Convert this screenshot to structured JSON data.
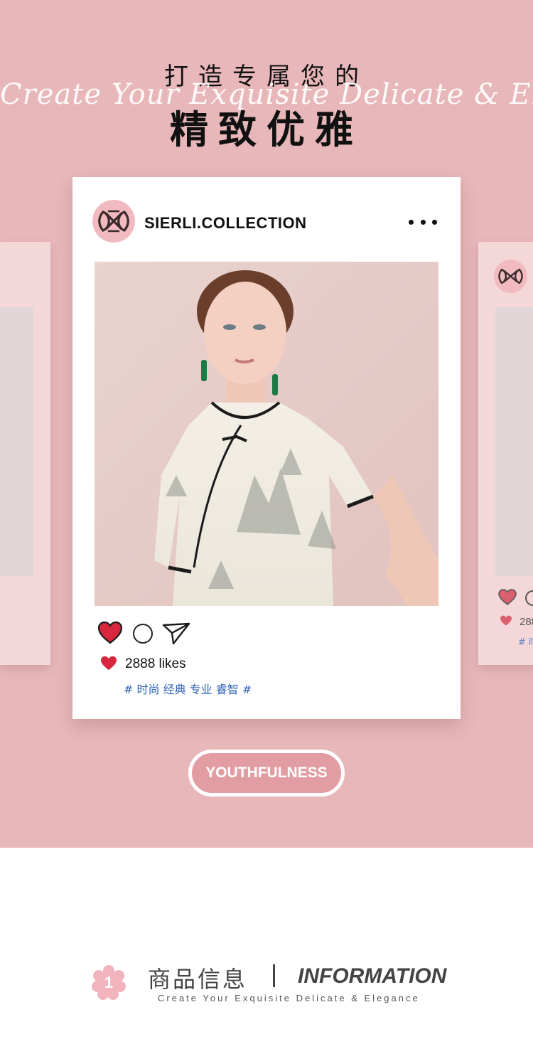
{
  "header": {
    "line1": "打造专属您的",
    "script": "Create Your Exquisite Delicate & Elegance",
    "line2": "精致优雅"
  },
  "post": {
    "account": "SIERLI.COLLECTION",
    "likes": "2888 likes",
    "hashtags": "# 时尚 经典 专业 睿智 #",
    "icons": [
      "heart-icon",
      "comment-icon",
      "share-icon",
      "more-icon"
    ]
  },
  "side_card_right": {
    "likes_partial": "288",
    "tag_partial": "# 时"
  },
  "badge": {
    "label": "YOUTHFULNESS"
  },
  "info_section": {
    "number": "1",
    "cn_title": "商品信息",
    "en_title": "INFORMATION",
    "subtitle": "Create Your Exquisite Delicate & Elegance"
  },
  "colors": {
    "background_pink": "#e8b7b9",
    "card_white": "#ffffff",
    "heart_red": "#d7263d",
    "hashtag_blue": "#2f63b6",
    "logo_pink": "#f1bac0"
  }
}
